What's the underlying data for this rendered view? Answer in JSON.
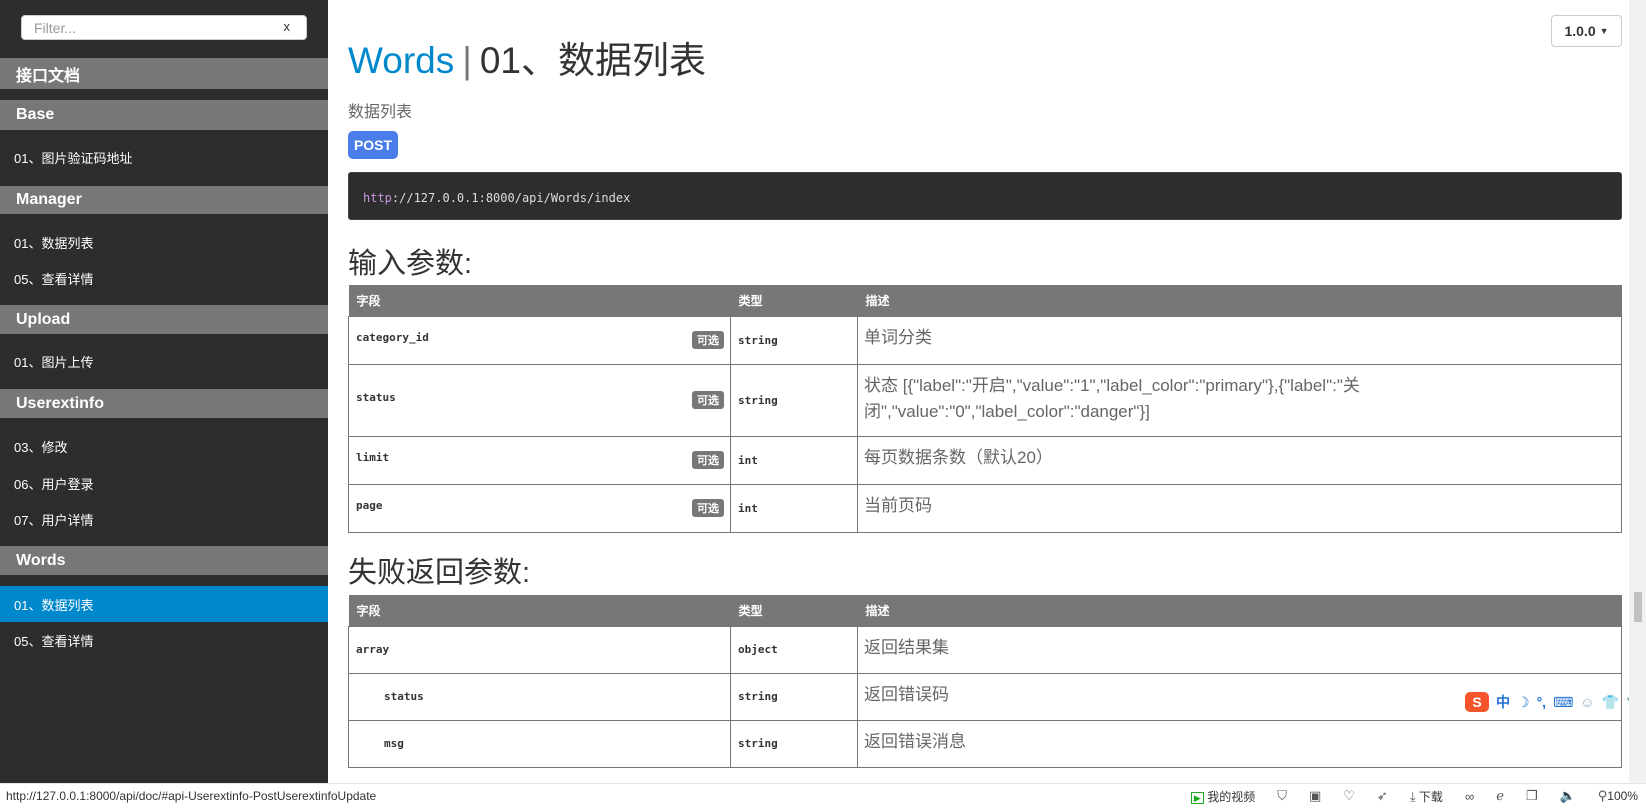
{
  "sidebar": {
    "filter_placeholder": "Filter...",
    "filter_clear": "x",
    "title": "接口文档",
    "sections": [
      {
        "label": "Base",
        "items": [
          "01、图片验证码地址"
        ]
      },
      {
        "label": "Manager",
        "items": [
          "01、数据列表",
          "05、查看详情"
        ]
      },
      {
        "label": "Upload",
        "items": [
          "01、图片上传"
        ]
      },
      {
        "label": "Userextinfo",
        "items": [
          "03、修改",
          "06、用户登录",
          "07、用户详情"
        ]
      },
      {
        "label": "Words",
        "items": [
          "01、数据列表",
          "05、查看详情"
        ]
      }
    ],
    "active": "Words / 01、数据列表"
  },
  "main": {
    "group": "Words",
    "separator": "|",
    "title": "01、数据列表",
    "version": "1.0.0",
    "subtitle": "数据列表",
    "method": "POST",
    "url_scheme": "http",
    "url_rest": "://127.0.0.1:8000/api/Words/index",
    "input_heading": "输入参数:",
    "fail_heading": "失败返回参数:",
    "columns": [
      "字段",
      "类型",
      "描述"
    ],
    "input_rows": [
      {
        "field": "category_id",
        "tag": "可选",
        "type": "string",
        "desc": "单词分类"
      },
      {
        "field": "status",
        "tag": "可选",
        "type": "string",
        "desc": "状态 [{\"label\":\"开启\",\"value\":\"1\",\"label_color\":\"primary\"},{\"label\":\"关闭\",\"value\":\"0\",\"label_color\":\"danger\"}]"
      },
      {
        "field": "limit",
        "tag": "可选",
        "type": "int",
        "desc": "每页数据条数（默认20）"
      },
      {
        "field": "page",
        "tag": "可选",
        "type": "int",
        "desc": "当前页码"
      }
    ],
    "fail_rows": [
      {
        "field": "array",
        "type": "object",
        "desc": "返回结果集"
      },
      {
        "field": "status",
        "type": "string",
        "desc": "返回错误码"
      },
      {
        "field": "msg",
        "type": "string",
        "desc": "返回错误消息"
      }
    ]
  },
  "ime": {
    "logo": "S",
    "mode": "中"
  },
  "statusbar": {
    "url": "http://127.0.0.1:8000/api/doc/#api-Userextinfo-PostUserextinfoUpdate",
    "video": "我的视频",
    "download": "下载",
    "zoom": "100%"
  },
  "colors": {
    "accent": "#0088cc",
    "post": "#4a7de9",
    "sidebar": "#2d2d2d",
    "section": "#777777"
  }
}
